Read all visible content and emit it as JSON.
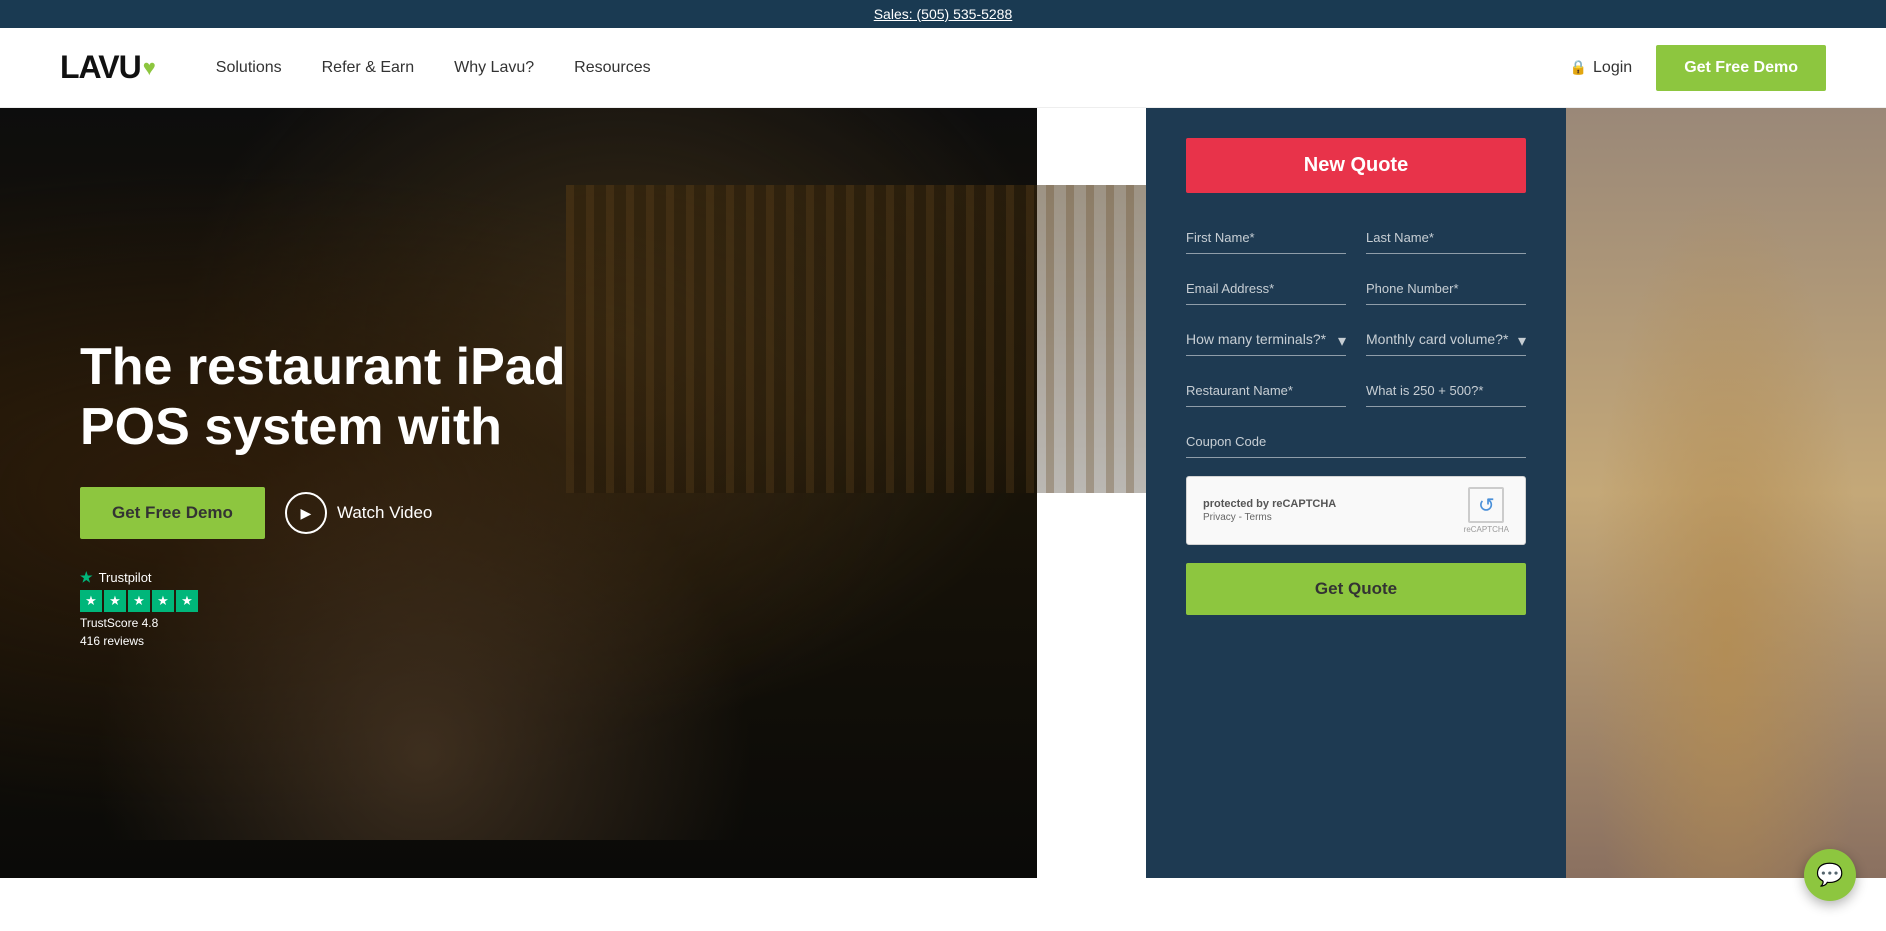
{
  "topbar": {
    "phone_text": "Sales: (505) 535-5288"
  },
  "nav": {
    "logo_text": "LAVU",
    "logo_heart": "♥",
    "links": [
      {
        "label": "Solutions",
        "id": "solutions"
      },
      {
        "label": "Refer & Earn",
        "id": "refer-earn"
      },
      {
        "label": "Why Lavu?",
        "id": "why-lavu"
      },
      {
        "label": "Resources",
        "id": "resources"
      }
    ],
    "login_label": "Login",
    "get_demo_label": "Get Free Demo"
  },
  "hero": {
    "title": "The restaurant iPad POS system with",
    "cta_demo": "Get Free Demo",
    "cta_video": "Watch Video",
    "trustpilot_label": "Trustpilot",
    "trustscore": "TrustScore 4.8",
    "reviews": "416 reviews"
  },
  "form": {
    "new_quote_label": "New Quote",
    "first_name_placeholder": "First Name*",
    "last_name_placeholder": "Last Name*",
    "email_placeholder": "Email Address*",
    "phone_placeholder": "Phone Number*",
    "terminals_placeholder": "How many terminals?*",
    "card_volume_placeholder": "Monthly card volume?*",
    "restaurant_name_placeholder": "Restaurant Name*",
    "math_placeholder": "What is 250 + 500?*",
    "coupon_placeholder": "Coupon Code",
    "get_quote_label": "Get Quote",
    "recaptcha_title": "protected by reCAPTCHA",
    "recaptcha_privacy": "Privacy",
    "recaptcha_terms": "Terms"
  },
  "chat": {
    "icon": "💬"
  }
}
